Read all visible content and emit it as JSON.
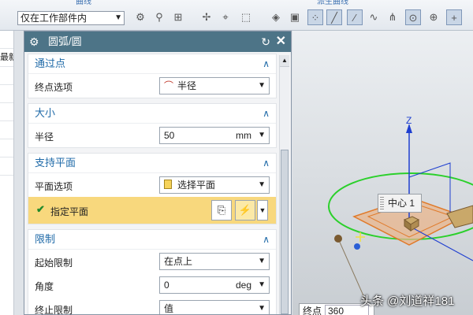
{
  "toolbar": {
    "ribbon_labels": [
      "曲线",
      "派生曲线"
    ],
    "scope_select": "仅在工作部件内",
    "icons": [
      "snap-icon",
      "filter-icon",
      "selection-icon",
      "point-icon",
      "snap-point-icon",
      "box-select-icon",
      "solid-icon",
      "face-icon",
      "control-point-icon",
      "endpoint-icon",
      "midpoint-icon",
      "tangent-icon",
      "intersection-icon",
      "center-icon",
      "quadrant-icon",
      "point-on-curve-icon"
    ]
  },
  "left_strip": {
    "rows": [
      "",
      "最新",
      "",
      "",
      "",
      "",
      "",
      "",
      "",
      "",
      "",
      ""
    ]
  },
  "dialog": {
    "title": "圆弧/圆",
    "sections": {
      "through_point": {
        "header": "通过点",
        "endpoint_option_label": "终点选项",
        "endpoint_option_value": "半径"
      },
      "size": {
        "header": "大小",
        "radius_label": "半径",
        "radius_value": "50",
        "radius_unit": "mm"
      },
      "support_plane": {
        "header": "支持平面",
        "plane_option_label": "平面选项",
        "plane_option_value": "选择平面",
        "specify_plane_label": "指定平面"
      },
      "limits": {
        "header": "限制",
        "start_limit_label": "起始限制",
        "start_limit_value": "在点上",
        "angle_label": "角度",
        "angle_value": "0",
        "angle_unit": "deg",
        "end_limit_label": "终止限制",
        "end_limit_value": "值"
      }
    }
  },
  "viewport": {
    "axis_label": "Z",
    "center_tip": "中心 1",
    "endpoint_label": "终点",
    "endpoint_value": "360",
    "watermark": "头条 @刘道祥181"
  },
  "colors": {
    "title_bar": "#4d7487",
    "section_header": "#1f6aa8",
    "highlight": "#f8d87d",
    "circle": "#2bd02b",
    "axis": "#1f3fd0"
  }
}
